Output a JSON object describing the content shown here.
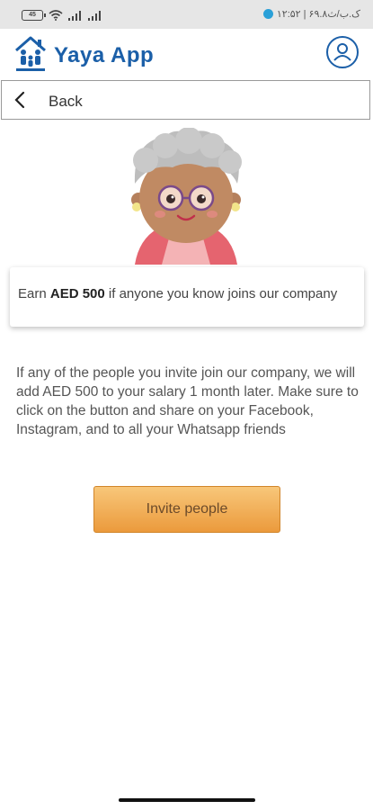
{
  "status_bar": {
    "battery": "45",
    "right_text": "۱۲:۵۲ | ۶۹.۸ک.ب/ث"
  },
  "header": {
    "app_title": "Yaya App",
    "brand_color": "#1b5fa8"
  },
  "nav": {
    "back_label": "Back"
  },
  "promo": {
    "prefix": "Earn ",
    "amount": "AED 500",
    "suffix": " if anyone you know joins our company"
  },
  "description": "If any of the people you invite join our company, we will add AED 500 to your salary 1 month later. Make sure to click on the button and share on your Facebook, Instagram, and to all your Whatsapp friends",
  "actions": {
    "invite_label": "Invite people",
    "accent_color": "#eb9a3c"
  }
}
